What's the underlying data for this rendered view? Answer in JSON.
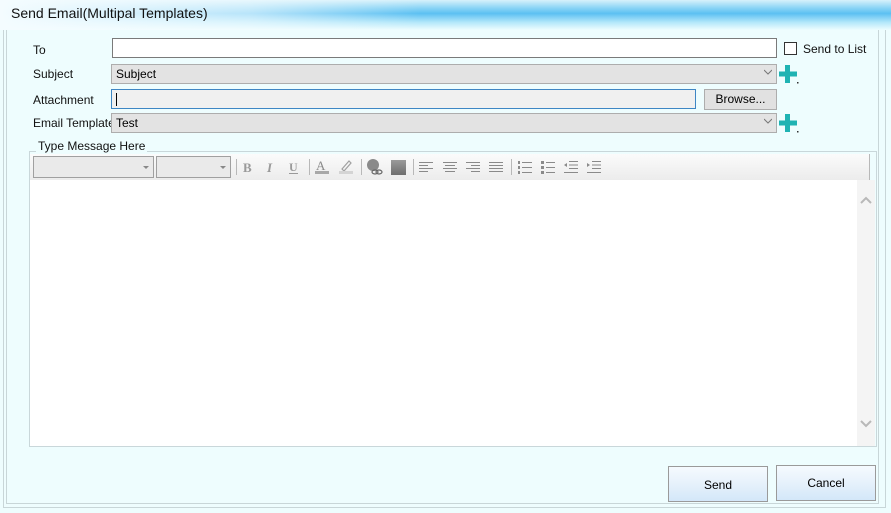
{
  "window": {
    "title": "Send Email(Multipal Templates)"
  },
  "form": {
    "to": {
      "label": "To",
      "value": "",
      "placeholder": ""
    },
    "send_to_list": {
      "label": "Send to List",
      "checked": false
    },
    "subject": {
      "label": "Subject",
      "selected": "Subject"
    },
    "attachment": {
      "label": "Attachment",
      "value": "",
      "browse_label": "Browse..."
    },
    "email_template": {
      "label": "Email Template",
      "selected": "Test"
    }
  },
  "message": {
    "group_title": "Type Message Here",
    "font_family": "",
    "font_size": "",
    "toolbar": [
      {
        "name": "bold-icon",
        "glyph": "B"
      },
      {
        "name": "italic-icon",
        "glyph": "I"
      },
      {
        "name": "underline-icon",
        "glyph": "U"
      },
      {
        "name": "font-color-icon",
        "glyph": "A"
      },
      {
        "name": "highlight-icon",
        "glyph": "✎"
      },
      {
        "name": "hyperlink-icon",
        "glyph": "link"
      },
      {
        "name": "insert-image-icon",
        "glyph": "img"
      },
      {
        "name": "align-left-icon",
        "glyph": "≡"
      },
      {
        "name": "align-center-icon",
        "glyph": "≡"
      },
      {
        "name": "align-right-icon",
        "glyph": "≡"
      },
      {
        "name": "justify-icon",
        "glyph": "≡"
      },
      {
        "name": "numbered-list-icon",
        "glyph": "1≡"
      },
      {
        "name": "bullet-list-icon",
        "glyph": "•≡"
      },
      {
        "name": "outdent-icon",
        "glyph": "⇤"
      },
      {
        "name": "indent-icon",
        "glyph": "⇥"
      }
    ],
    "body": ""
  },
  "actions": {
    "send_label": "Send",
    "cancel_label": "Cancel"
  },
  "colors": {
    "accent_plus": "#1fb3b3",
    "background": "#eefdfe"
  }
}
